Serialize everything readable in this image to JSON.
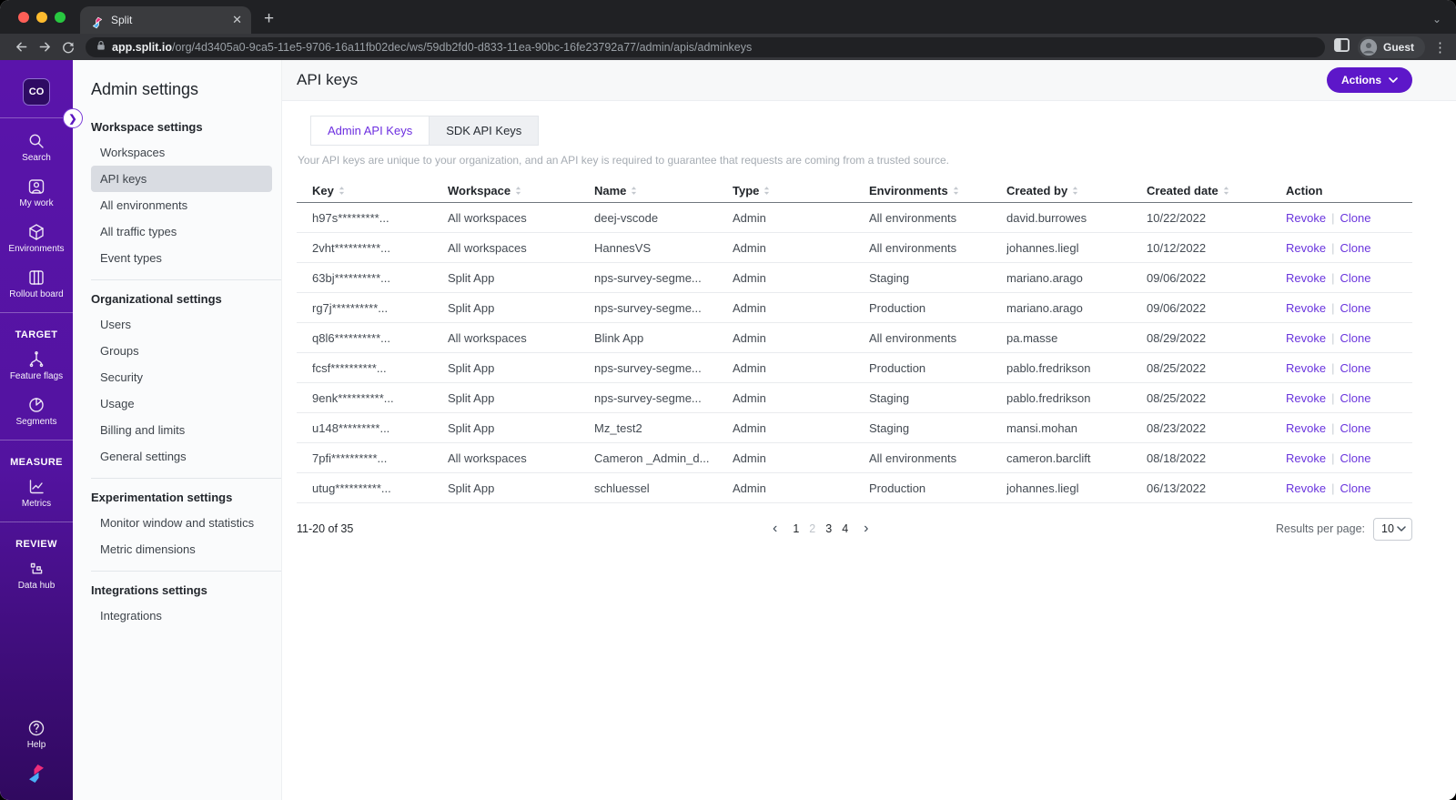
{
  "browser": {
    "tab_title": "Split",
    "url": {
      "domain": "app.split.io",
      "path": "/org/4d3405a0-9ca5-11e5-9706-16a11fb02dec/ws/59db2fd0-d833-11ea-90bc-16fe23792a77/admin/apis/adminkeys"
    },
    "guest_label": "Guest"
  },
  "colors": {
    "accent_purple": "#5d17c9",
    "link_purple": "#6a35dd",
    "active_tab_text": "#6d2fe0",
    "sidebar_purple_top": "#5a14ab",
    "sidebar_purple_bottom": "#30095f",
    "selected_nav_bg": "#d9dce2"
  },
  "sidebar": {
    "workspace_badge": "CO",
    "groups": [
      {
        "header": null,
        "items": [
          {
            "icon": "search",
            "label": "Search"
          },
          {
            "icon": "my-work",
            "label": "My work"
          },
          {
            "icon": "environments",
            "label": "Environments"
          },
          {
            "icon": "rollout-board",
            "label": "Rollout board"
          }
        ]
      },
      {
        "header": "TARGET",
        "items": [
          {
            "icon": "feature-flags",
            "label": "Feature flags"
          },
          {
            "icon": "segments",
            "label": "Segments"
          }
        ]
      },
      {
        "header": "MEASURE",
        "items": [
          {
            "icon": "metrics",
            "label": "Metrics"
          }
        ]
      },
      {
        "header": "REVIEW",
        "items": [
          {
            "icon": "data-hub",
            "label": "Data hub"
          }
        ]
      }
    ],
    "help_label": "Help"
  },
  "admin_nav": {
    "title": "Admin settings",
    "sections": [
      {
        "header": "Workspace settings",
        "selected": "API keys",
        "items": [
          "Workspaces",
          "API keys",
          "All environments",
          "All traffic types",
          "Event types"
        ]
      },
      {
        "header": "Organizational settings",
        "items": [
          "Users",
          "Groups",
          "Security",
          "Usage",
          "Billing and limits",
          "General settings"
        ]
      },
      {
        "header": "Experimentation settings",
        "items": [
          "Monitor window and statistics",
          "Metric dimensions"
        ]
      },
      {
        "header": "Integrations settings",
        "items": [
          "Integrations"
        ]
      }
    ]
  },
  "main": {
    "title": "API keys",
    "actions_label": "Actions",
    "tabs": [
      {
        "label": "Admin API Keys",
        "active": true
      },
      {
        "label": "SDK API Keys",
        "active": false
      }
    ],
    "description": "Your API keys are unique to your organization, and an API key is required to guarantee that requests are coming from a trusted source.",
    "table": {
      "columns": [
        {
          "label": "Key",
          "sortable": true
        },
        {
          "label": "Workspace",
          "sortable": true
        },
        {
          "label": "Name",
          "sortable": true
        },
        {
          "label": "Type",
          "sortable": true
        },
        {
          "label": "Environments",
          "sortable": true
        },
        {
          "label": "Created by",
          "sortable": true
        },
        {
          "label": "Created date",
          "sortable": true
        },
        {
          "label": "Action",
          "sortable": false
        }
      ],
      "row_actions": [
        "Revoke",
        "Clone"
      ],
      "rows": [
        {
          "cells": [
            "h97s*********...",
            "All workspaces",
            "deej-vscode",
            "Admin",
            "All environments",
            "david.burrowes",
            "10/22/2022"
          ]
        },
        {
          "cells": [
            "2vht**********...",
            "All workspaces",
            "HannesVS",
            "Admin",
            "All environments",
            "johannes.liegl",
            "10/12/2022"
          ]
        },
        {
          "cells": [
            "63bj**********...",
            "Split App",
            "nps-survey-segme...",
            "Admin",
            "Staging",
            "mariano.arago",
            "09/06/2022"
          ]
        },
        {
          "cells": [
            "rg7j**********...",
            "Split App",
            "nps-survey-segme...",
            "Admin",
            "Production",
            "mariano.arago",
            "09/06/2022"
          ]
        },
        {
          "cells": [
            "q8l6**********...",
            "All workspaces",
            "Blink App",
            "Admin",
            "All environments",
            "pa.masse",
            "08/29/2022"
          ]
        },
        {
          "cells": [
            "fcsf**********...",
            "Split App",
            "nps-survey-segme...",
            "Admin",
            "Production",
            "pablo.fredrikson",
            "08/25/2022"
          ]
        },
        {
          "cells": [
            "9enk**********...",
            "Split App",
            "nps-survey-segme...",
            "Admin",
            "Staging",
            "pablo.fredrikson",
            "08/25/2022"
          ]
        },
        {
          "cells": [
            "u148*********...",
            "Split App",
            "Mz_test2",
            "Admin",
            "Staging",
            "mansi.mohan",
            "08/23/2022"
          ]
        },
        {
          "cells": [
            "7pfi**********...",
            "All workspaces",
            "Cameron _Admin_d...",
            "Admin",
            "All environments",
            "cameron.barclift",
            "08/18/2022"
          ]
        },
        {
          "cells": [
            "utug**********...",
            "Split App",
            "schluessel",
            "Admin",
            "Production",
            "johannes.liegl",
            "06/13/2022"
          ]
        }
      ]
    },
    "pagination": {
      "range": "11-20 of 35",
      "pages": [
        "1",
        "2",
        "3",
        "4"
      ],
      "current": "2",
      "results_per_page_label": "Results per page:",
      "per_page": "10"
    }
  }
}
